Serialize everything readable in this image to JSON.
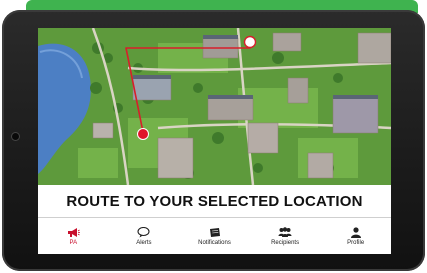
{
  "banner": {
    "title": "ROUTE TO YOUR SELECTED LOCATION"
  },
  "tabs": [
    {
      "label": "PA",
      "icon": "megaphone-icon",
      "active": true
    },
    {
      "label": "Alerts",
      "icon": "chat-bubble-icon",
      "active": false
    },
    {
      "label": "Notifications",
      "icon": "notebook-icon",
      "active": false
    },
    {
      "label": "Recipients",
      "icon": "group-icon",
      "active": false
    },
    {
      "label": "Profile",
      "icon": "person-icon",
      "active": false
    }
  ],
  "colors": {
    "accent": "#c8102e",
    "frame_strip": "#3fb34f",
    "route": "#d81e2a"
  }
}
